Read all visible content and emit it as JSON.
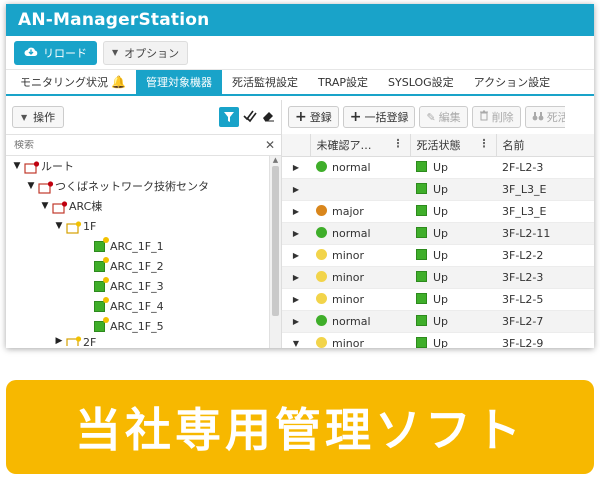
{
  "app": {
    "title": "AN-ManagerStation"
  },
  "toolbar": {
    "reload_label": "リロード",
    "option_label": "オプション"
  },
  "tabs": [
    {
      "label": "モニタリング状況",
      "active": false
    },
    {
      "label": "管理対象機器",
      "active": true
    },
    {
      "label": "死活監視設定",
      "active": false
    },
    {
      "label": "TRAP設定",
      "active": false
    },
    {
      "label": "SYSLOG設定",
      "active": false
    },
    {
      "label": "アクション設定",
      "active": false
    }
  ],
  "left_panel": {
    "operation_label": "操作",
    "search_placeholder": "検索",
    "tree": [
      {
        "label": "ルート"
      },
      {
        "label": "つくばネットワーク技術センタ"
      },
      {
        "label": "ARC棟"
      },
      {
        "label": "1F"
      },
      {
        "label": "ARC_1F_1"
      },
      {
        "label": "ARC_1F_2"
      },
      {
        "label": "ARC_1F_3"
      },
      {
        "label": "ARC_1F_4"
      },
      {
        "label": "ARC_1F_5"
      },
      {
        "label": "2F"
      }
    ]
  },
  "right_panel": {
    "buttons": {
      "register": "登録",
      "bulk_register": "一括登録",
      "edit": "編集",
      "delete": "削除",
      "alive": "死活"
    },
    "columns": {
      "unconfirmed": "未確認ア…",
      "alive_status": "死活状態",
      "name": "名前"
    },
    "rows": [
      {
        "severity": "normal",
        "status": "Up",
        "name": "2F-L2-3"
      },
      {
        "severity": "",
        "status": "Up",
        "name": "3F_L3_E"
      },
      {
        "severity": "major",
        "status": "Up",
        "name": "3F_L3_E"
      },
      {
        "severity": "normal",
        "status": "Up",
        "name": "3F-L2-11"
      },
      {
        "severity": "minor",
        "status": "Up",
        "name": "3F-L2-2"
      },
      {
        "severity": "minor",
        "status": "Up",
        "name": "3F-L2-3"
      },
      {
        "severity": "minor",
        "status": "Up",
        "name": "3F-L2-5"
      },
      {
        "severity": "normal",
        "status": "Up",
        "name": "3F-L2-7"
      },
      {
        "severity": "minor",
        "status": "Up",
        "name": "3F-L2-9"
      }
    ]
  },
  "banner": {
    "text": "当社専用管理ソフト"
  },
  "colors": {
    "accent": "#19a3c9",
    "banner": "#f7b800",
    "normal": "#3fae2a",
    "minor": "#f2d44a",
    "major": "#d9861c"
  }
}
